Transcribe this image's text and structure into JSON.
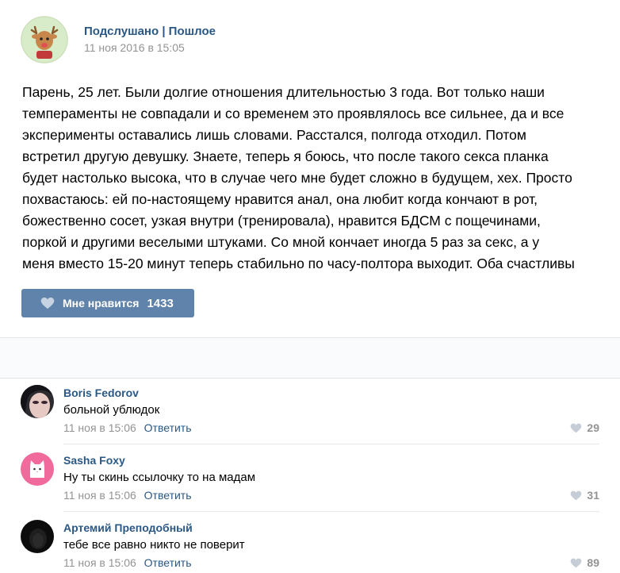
{
  "post": {
    "group_name": "Подслушано | Пошлое",
    "date": "11 ноя 2016 в 15:05",
    "text_lines": [
      "Парень, 25 лет. Были долгие отношения длительностью 3 года. Вот только наши",
      "темпераменты не совпадали и со временем это проявлялось все сильнее, да и все",
      "эксперименты оставались лишь словами. Расстался, полгода отходил. Потом",
      "встретил другую девушку. Знаете, теперь я боюсь, что после такого секса планка",
      "будет настолько высока, что в случае чего мне будет сложно в будущем, хех. Просто",
      "похвастаюсь: ей по-настоящему нравится анал, она любит когда кончают в рот,",
      "божественно сосет, узкая внутри (тренировала), нравится БДСМ с пощечинами,",
      "поркой и другими веселыми штуками. Со мной кончает иногда 5 раз за секс, а у",
      "меня вместо 15-20 минут теперь стабильно по часу-полтора выходит. Оба счастливы"
    ],
    "like_label": "Мне нравится",
    "like_count": "1433",
    "like_icon": "heart-icon"
  },
  "comments": [
    {
      "author": "Boris Fedorov",
      "text": "больной ублюдок",
      "date": "11 ноя в 15:06",
      "reply_label": "Ответить",
      "likes": "29"
    },
    {
      "author": "Sasha Foxy",
      "text": "Ну ты скинь ссылочку то на мадам",
      "date": "11 ноя в 15:06",
      "reply_label": "Ответить",
      "likes": "31"
    },
    {
      "author": "Артемий Преподобный",
      "text": "тебе все равно никто не поверит",
      "date": "11 ноя в 15:06",
      "reply_label": "Ответить",
      "likes": "89"
    }
  ],
  "colors": {
    "link": "#2a5885",
    "muted": "#939393",
    "like_button": "#5f83aa"
  }
}
